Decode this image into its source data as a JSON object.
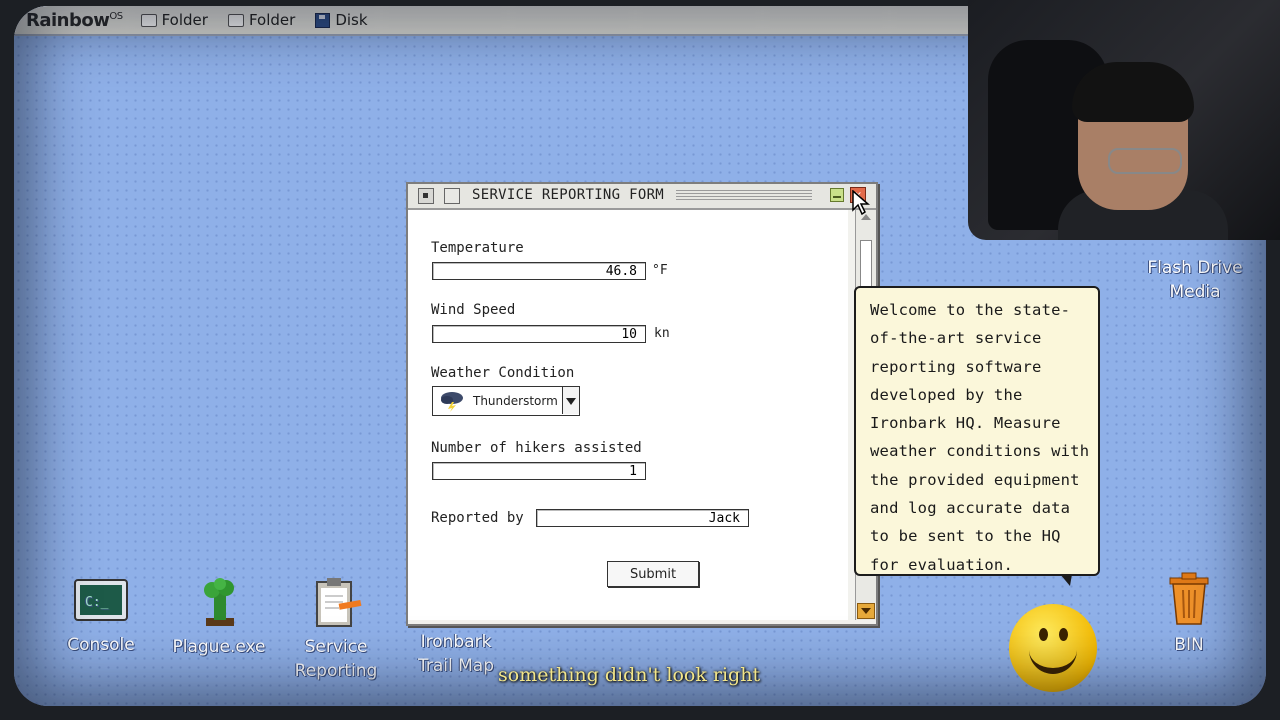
{
  "menubar": {
    "logo": "Rainbow",
    "logo_sup": "OS",
    "items": [
      {
        "label": "Folder",
        "icon": "folder-icon"
      },
      {
        "label": "Folder",
        "icon": "folder-icon"
      },
      {
        "label": "Disk",
        "icon": "disk-icon"
      }
    ]
  },
  "desktop": {
    "icons": [
      {
        "label": "Console"
      },
      {
        "label": "Plague.exe"
      },
      {
        "label_line1": "Service",
        "label_line2": "Reporting"
      },
      {
        "label_line1": "Ironbark",
        "label_line2": "Trail Map"
      },
      {
        "label_line1": "Flash Drive",
        "label_line2": "Media"
      },
      {
        "label": "BIN"
      }
    ]
  },
  "window": {
    "title": "SERVICE REPORTING FORM",
    "fields": {
      "temperature_label": "Temperature",
      "temperature_value": "46.8",
      "temperature_unit": "°F",
      "wind_label": "Wind Speed",
      "wind_value": "10",
      "wind_unit": "kn",
      "condition_label": "Weather Condition",
      "condition_value": "Thunderstorm",
      "hikers_label": "Number of hikers assisted",
      "hikers_value": "1",
      "reported_label": "Reported by",
      "reported_value": "Jack"
    },
    "submit_label": "Submit"
  },
  "tooltip": {
    "lines": [
      "Welcome to the state-",
      "of-the-art service",
      "reporting software",
      "developed by the",
      "Ironbark HQ. Measure",
      "weather conditions with",
      "the provided equipment",
      "and log accurate data",
      "to be sent to the HQ",
      "for evaluation."
    ]
  },
  "caption": "something didn't look right",
  "colors": {
    "desktop": "#8fb0e8",
    "tooltip": "#fbf7da",
    "caption": "#f3e68a"
  }
}
